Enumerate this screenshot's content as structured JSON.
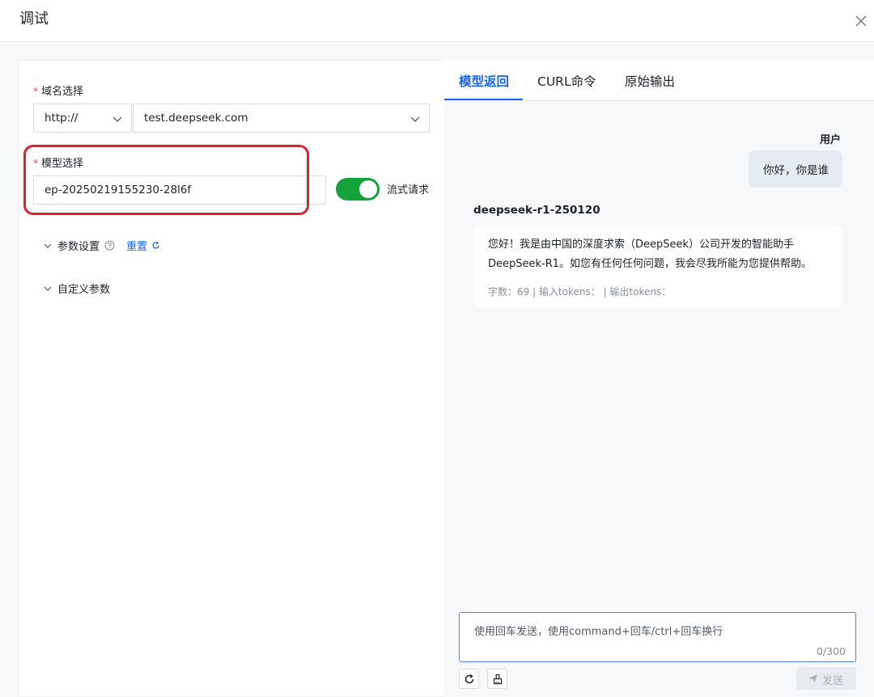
{
  "header": {
    "title": "调试"
  },
  "left": {
    "domain_label": "域名选择",
    "protocol_value": "http://",
    "domain_value": "test.deepseek.com",
    "model_label": "模型选择",
    "model_value": "ep-20250219155230-28l6f",
    "stream_label": "流式请求",
    "stream_on": true,
    "params_label": "参数设置",
    "reset_label": "重置",
    "custom_params_label": "自定义参数"
  },
  "tabs": [
    {
      "label": "模型返回",
      "active": true
    },
    {
      "label": "CURL命令",
      "active": false
    },
    {
      "label": "原始输出",
      "active": false
    }
  ],
  "chat": {
    "user_name": "用户",
    "user_message": "你好，你是谁",
    "bot_name": "deepseek-r1-250120",
    "bot_message": "您好！我是由中国的深度求索（DeepSeek）公司开发的智能助手DeepSeek-R1。如您有任何任何问题，我会尽我所能为您提供帮助。",
    "bot_stats": "字数：69 | 输入tokens：  | 输出tokens："
  },
  "composer": {
    "placeholder": "使用回车发送，使用command+回车/ctrl+回车换行",
    "count": "0/300",
    "send_label": "发送"
  },
  "colors": {
    "accent": "#1664ff",
    "toggle_on": "#14a33b",
    "highlight": "#e0202a"
  }
}
